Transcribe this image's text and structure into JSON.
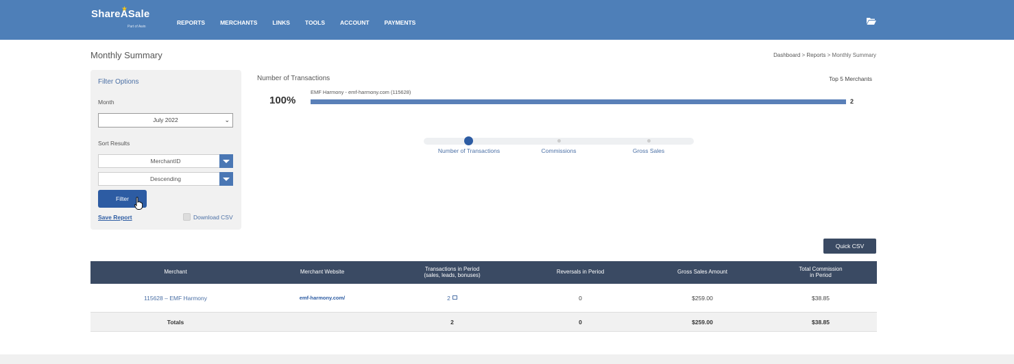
{
  "header": {
    "logo_text": "ShareASale",
    "logo_sub": "Part of Awin",
    "nav": [
      {
        "label": "REPORTS"
      },
      {
        "label": "MERCHANTS"
      },
      {
        "label": "LINKS"
      },
      {
        "label": "TOOLS"
      },
      {
        "label": "ACCOUNT"
      },
      {
        "label": "PAYMENTS"
      }
    ],
    "right_icon": "folder-open-icon"
  },
  "page": {
    "title": "Monthly Summary",
    "breadcrumb": [
      "Dashboard",
      "Reports",
      "Monthly Summary"
    ],
    "breadcrumb_sep": " > "
  },
  "filter": {
    "title": "Filter Options",
    "month_label": "Month",
    "month_value": "July 2022",
    "sort_label": "Sort Results",
    "sort_by": "MerchantID",
    "sort_order": "Descending",
    "filter_button": "Filter",
    "save_report": "Save Report",
    "download_csv_label": "Download CSV",
    "download_csv_checked": false
  },
  "chart": {
    "title": "Number of Transactions",
    "top_label": "Top 5 Merchants",
    "bars": [
      {
        "label": "EMF Harmony - emf-harmony.com (115628)",
        "percent": "100%",
        "value": "2",
        "fraction": 1.0
      }
    ],
    "steps": [
      {
        "label": "Number of Transactions",
        "active": true
      },
      {
        "label": "Commissions",
        "active": false
      },
      {
        "label": "Gross Sales",
        "active": false
      }
    ]
  },
  "quick_csv": "Quick CSV",
  "table": {
    "headers": [
      {
        "line1": "Merchant",
        "line2": ""
      },
      {
        "line1": "Merchant Website",
        "line2": ""
      },
      {
        "line1": "Transactions in Period",
        "line2": "(sales, leads, bonuses)"
      },
      {
        "line1": "Reversals in Period",
        "line2": ""
      },
      {
        "line1": "Gross Sales Amount",
        "line2": ""
      },
      {
        "line1": "Total Commission",
        "line2": "in Period"
      }
    ],
    "rows": [
      {
        "merchant": "115628 – EMF Harmony",
        "website": "emf-harmony.com/",
        "transactions": "2",
        "reversals": "0",
        "gross_sales": "$259.00",
        "commission": "$38.85"
      }
    ],
    "totals": {
      "label": "Totals",
      "transactions": "2",
      "reversals": "0",
      "gross_sales": "$259.00",
      "commission": "$38.85"
    }
  },
  "colors": {
    "header_bg": "#4e7fb8",
    "accent": "#2d5ca3",
    "table_header_bg": "#3a4a63",
    "bar_fill": "#5a80b8"
  }
}
